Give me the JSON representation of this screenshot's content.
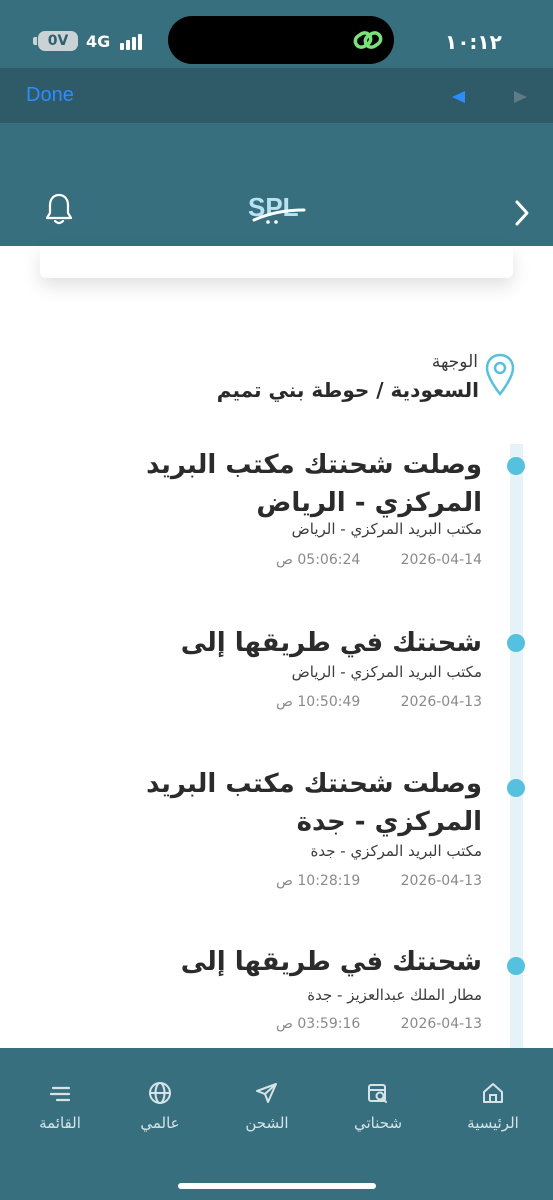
{
  "status_bar": {
    "battery": "0V",
    "network": "4G",
    "time": "١٠:١٢"
  },
  "browser_bar": {
    "done_label": "Done"
  },
  "header": {
    "logo_text": "SPL"
  },
  "destination": {
    "label": "الوجهة",
    "value": "السعودية / حوطة بني تميم"
  },
  "events": [
    {
      "title": "وصلت شحنتك مكتب البريد المركزي - الرياض",
      "location": "مكتب البريد المركزي - الرياض",
      "date": "2026-04-14",
      "time": "05:06:24 ص"
    },
    {
      "title": "شحنتك في طريقها إلى",
      "location": "مكتب البريد المركزي - الرياض",
      "date": "2026-04-13",
      "time": "10:50:49 ص"
    },
    {
      "title": "وصلت شحنتك مكتب البريد المركزي - جدة",
      "location": "مكتب البريد المركزي - جدة",
      "date": "2026-04-13",
      "time": "10:28:19 ص"
    },
    {
      "title": "شحنتك في طريقها إلى",
      "location": "مطار الملك عبدالعزيز - جدة",
      "date": "2026-04-13",
      "time": "03:59:16 ص"
    }
  ],
  "bottom_nav": {
    "menu": "القائمة",
    "global": "عالمي",
    "shipping": "الشحن",
    "my_shipments": "شحناتي",
    "home": "الرئيسية"
  },
  "colors": {
    "header_bg": "#386f7f",
    "browser_bar_bg": "#2f5a68",
    "accent_dot": "#55c1de",
    "timeline_track": "#e5f3f8",
    "link_blue": "#2c8dff"
  },
  "icons": [
    "battery-icon",
    "signal-icon",
    "link-icon",
    "bell-icon",
    "chevron-right-icon",
    "location-pin-icon",
    "menu-icon",
    "globe-icon",
    "send-icon",
    "package-search-icon",
    "home-icon"
  ]
}
